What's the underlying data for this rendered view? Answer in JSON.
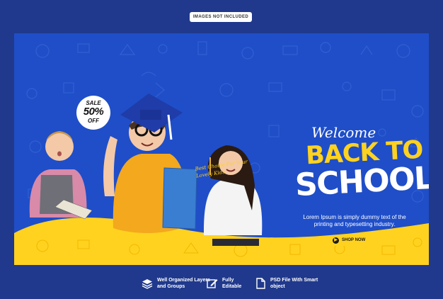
{
  "top_badge": "IMAGES NOT INCLUDED",
  "sale": {
    "line1": "SALE",
    "line2": "50%",
    "line3": "OFF"
  },
  "tagline": "Best Choice For Your Lovely Kids",
  "welcome": "Welcome",
  "title_line1": "BACK TO",
  "title_line2": "SCHOOL",
  "description": "Lorem Ipsum is simply dummy text of the printing and typesetting industry.",
  "shop_button": "SHOP NOW",
  "features": [
    {
      "icon": "layers-icon",
      "label": "Well Organized Layers and Groups"
    },
    {
      "icon": "edit-icon",
      "label": "Fully Editable"
    },
    {
      "icon": "file-icon",
      "label": "PSD File With Smart object"
    }
  ],
  "colors": {
    "background": "#20398c",
    "banner": "#1f4ec8",
    "accent": "#ffd21f"
  }
}
